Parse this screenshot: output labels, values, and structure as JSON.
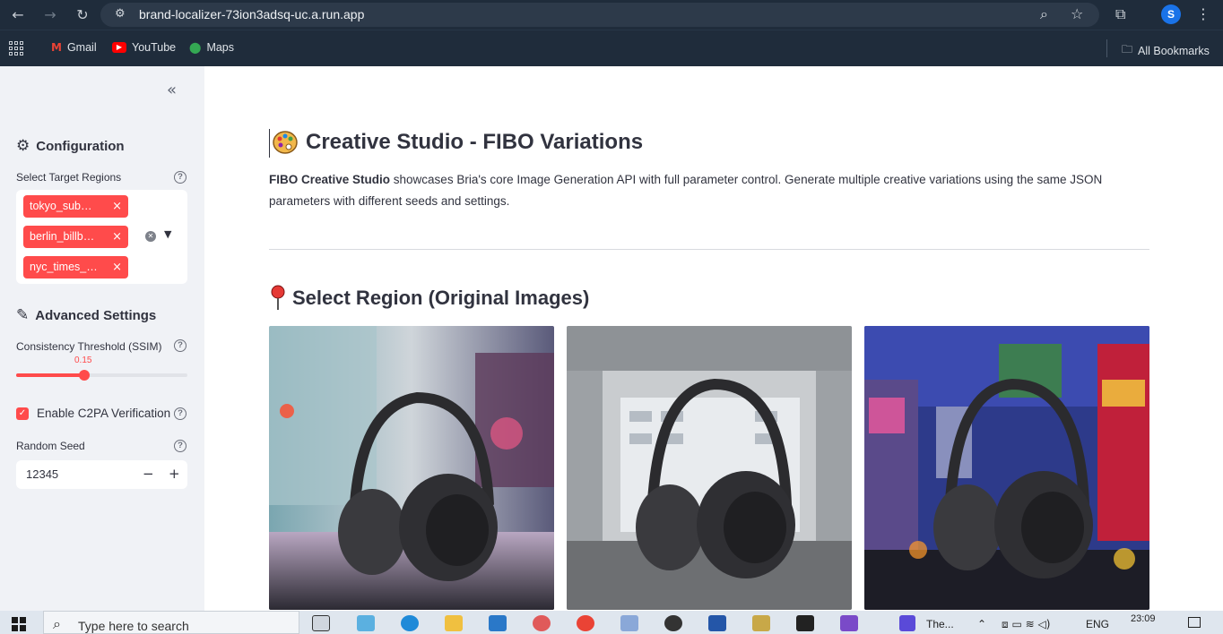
{
  "browser": {
    "url": "brand-localizer-73ion3adsq-uc.a.run.app",
    "profile_initial": "S",
    "bookmarks": [
      {
        "label": "Gmail",
        "icon": "gmail-icon"
      },
      {
        "label": "YouTube",
        "icon": "youtube-icon"
      },
      {
        "label": "Maps",
        "icon": "maps-icon"
      }
    ],
    "all_bookmarks": "All Bookmarks"
  },
  "sidebar": {
    "configuration_title": "Configuration",
    "target_regions_label": "Select Target Regions",
    "selected_regions": [
      "tokyo_sub…",
      "berlin_billb…",
      "nyc_times_…"
    ],
    "advanced_title": "Advanced Settings",
    "ssim_label": "Consistency Threshold (SSIM)",
    "ssim_value": "0.15",
    "ssim_fraction": 0.4,
    "c2pa_label": "Enable C2PA Verification",
    "c2pa_checked": true,
    "seed_label": "Random Seed",
    "seed_value": "12345",
    "accent_color": "#ff4b4b"
  },
  "main": {
    "title": "Creative Studio - FIBO Variations",
    "desc_bold": "FIBO Creative Studio",
    "desc_rest": " showcases Bria's core Image Generation API with full parameter control. Generate multiple creative variations using the same JSON parameters with different seeds and settings.",
    "section_title": "Select Region (Original Images)"
  },
  "taskbar": {
    "search_placeholder": "Type here to search",
    "task_label": "The...",
    "lang": "ENG",
    "time": "23:09"
  }
}
